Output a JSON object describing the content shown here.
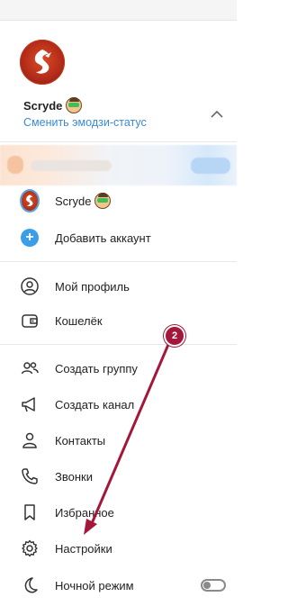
{
  "profile": {
    "name": "Scryde",
    "status_link": "Сменить эмодзи-статус"
  },
  "accounts": [
    {
      "name": "Scryde"
    },
    {
      "name": "Добавить аккаунт"
    }
  ],
  "menu": [
    {
      "label": "Мой профиль",
      "icon": "person-circle-icon"
    },
    {
      "label": "Кошелёк",
      "icon": "wallet-icon"
    },
    {
      "label": "Создать группу",
      "icon": "group-icon"
    },
    {
      "label": "Создать канал",
      "icon": "megaphone-icon"
    },
    {
      "label": "Контакты",
      "icon": "contact-icon"
    },
    {
      "label": "Звонки",
      "icon": "phone-icon"
    },
    {
      "label": "Избранное",
      "icon": "bookmark-icon"
    },
    {
      "label": "Настройки",
      "icon": "gear-icon"
    },
    {
      "label": "Ночной режим",
      "icon": "moon-icon"
    }
  ],
  "night_mode_on": false,
  "annotation": {
    "badge": "2"
  },
  "colors": {
    "accent": "#3a8ad8",
    "annotation": "#a5173a",
    "brand_avatar": "#c23b20"
  }
}
